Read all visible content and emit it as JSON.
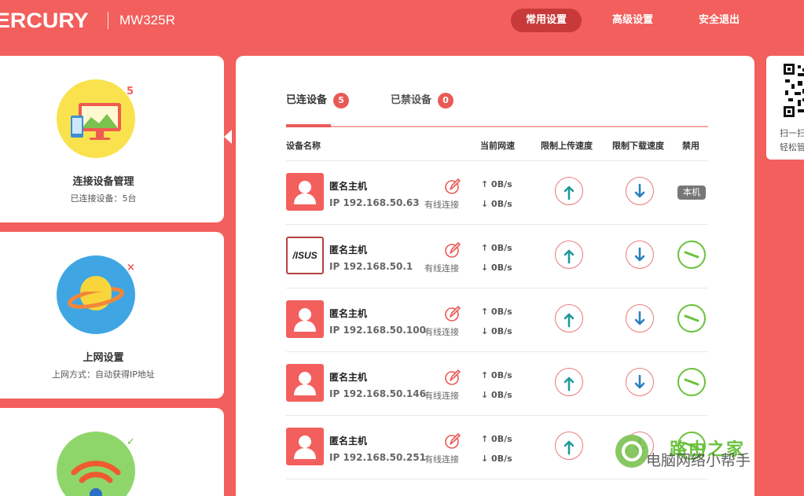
{
  "header": {
    "logo_text": "ERCURY",
    "model": "MW325R",
    "nav": [
      {
        "label": "常用设置",
        "active": true
      },
      {
        "label": "高级设置",
        "active": false
      },
      {
        "label": "安全退出",
        "active": false
      }
    ]
  },
  "left_panel": {
    "cards": [
      {
        "title": "连接设备管理",
        "subtitle": "已连接设备：5台",
        "badge": "5",
        "icon": "monitor-phone-icon"
      },
      {
        "title": "上网设置",
        "subtitle": "上网方式：自动获得IP地址",
        "badge": "×",
        "icon": "planet-icon"
      },
      {
        "title": "",
        "subtitle": "",
        "badge": "✓",
        "icon": "wifi-icon"
      }
    ]
  },
  "main": {
    "tabs": [
      {
        "label": "已连设备",
        "count": "5",
        "active": true
      },
      {
        "label": "已禁设备",
        "count": "0",
        "active": false
      }
    ],
    "columns": {
      "name": "设备名称",
      "speed": "当前网速",
      "upload": "限制上传速度",
      "download": "限制下载速度",
      "ban": "禁用"
    },
    "devices": [
      {
        "name": "匿名主机",
        "ip": "IP 192.168.50.63",
        "connection": "有线连接",
        "up": "↑ 0B/s",
        "down": "↓ 0B/s",
        "avatar": "person-icon",
        "ban": "本机"
      },
      {
        "name": "匿名主机",
        "ip": "IP 192.168.50.1",
        "connection": "有线连接",
        "up": "↑ 0B/s",
        "down": "↓ 0B/s",
        "avatar": "asus-logo",
        "ban": ""
      },
      {
        "name": "匿名主机",
        "ip": "IP 192.168.50.100",
        "connection": "有线连接",
        "up": "↑ 0B/s",
        "down": "↓ 0B/s",
        "avatar": "person-icon",
        "ban": ""
      },
      {
        "name": "匿名主机",
        "ip": "IP 192.168.50.146",
        "connection": "有线连接",
        "up": "↑ 0B/s",
        "down": "↓ 0B/s",
        "avatar": "person-icon",
        "ban": ""
      },
      {
        "name": "匿名主机",
        "ip": "IP 192.168.50.251",
        "connection": "有线连接",
        "up": "↑ 0B/s",
        "down": "↓ 0B/s",
        "avatar": "person-icon",
        "ban": ""
      }
    ],
    "asus_text": "/ISUS"
  },
  "qr": {
    "line1": "扫一扫",
    "line2": "轻松管"
  },
  "watermark": {
    "line1": "路由之家",
    "line2": "电脑网络小帮手"
  },
  "colors": {
    "brand": "#f25f5c",
    "accent_dark": "#c8393a",
    "green": "#6ac13d",
    "blue_arrow": "#2a7fc1",
    "teal_arrow": "#1f9a9a"
  }
}
